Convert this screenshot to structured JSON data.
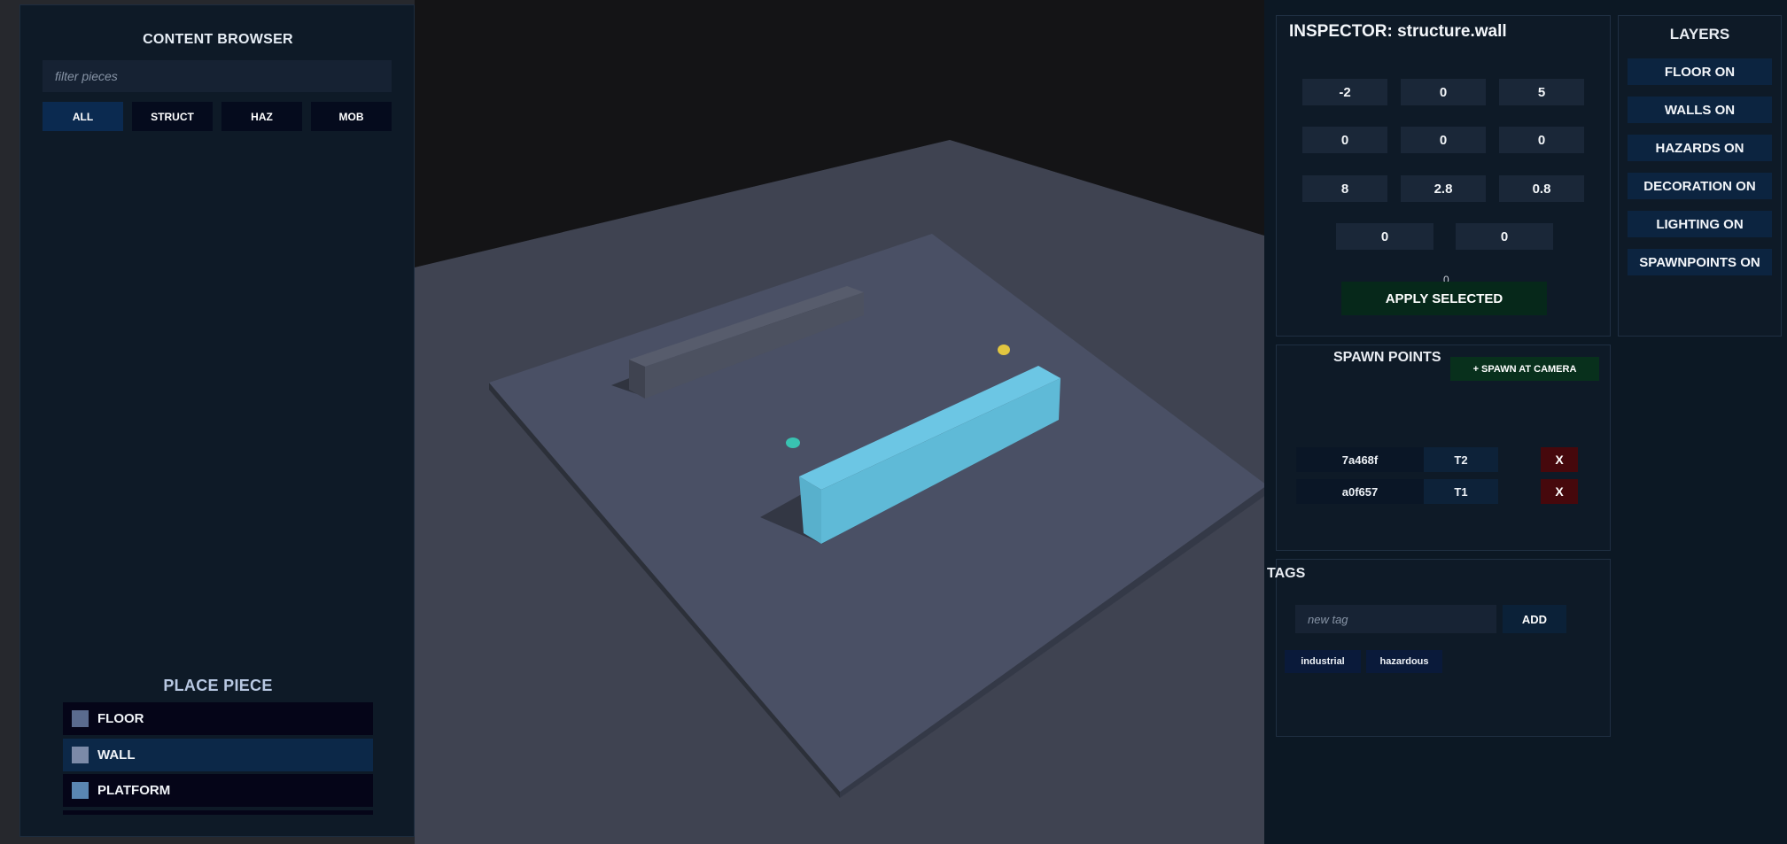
{
  "content_browser": {
    "title": "CONTENT BROWSER",
    "filter_placeholder": "filter pieces",
    "filters": [
      "ALL",
      "STRUCT",
      "HAZ",
      "MOB"
    ],
    "active_filter": "ALL"
  },
  "place_piece": {
    "title": "PLACE PIECE",
    "items": [
      "FLOOR",
      "WALL",
      "PLATFORM"
    ],
    "selected": "WALL"
  },
  "inspector": {
    "title": "INSPECTOR: structure.wall",
    "position": [
      "-2",
      "0",
      "5"
    ],
    "rotation": [
      "0",
      "0",
      "0"
    ],
    "scale": [
      "8",
      "2.8",
      "0.8"
    ],
    "extra": [
      "0",
      "0"
    ],
    "partial_value": "0",
    "apply_label": "APPLY SELECTED"
  },
  "layers": {
    "title": "LAYERS",
    "items": [
      "FLOOR ON",
      "WALLS ON",
      "HAZARDS ON",
      "DECORATION ON",
      "LIGHTING ON",
      "SPAWNPOINTS ON"
    ]
  },
  "spawn_points": {
    "title": "SPAWN POINTS",
    "spawn_label": "+ SPAWN AT CAMERA",
    "rows": [
      {
        "id": "7a468f",
        "team": "T2",
        "delete": "X"
      },
      {
        "id": "a0f657",
        "team": "T1",
        "delete": "X"
      }
    ]
  },
  "tags": {
    "title": "TAGS",
    "input_placeholder": "new tag",
    "add_label": "ADD",
    "items": [
      "industrial",
      "hazardous"
    ]
  },
  "colors": {
    "selected_wall": "#6cc6e4",
    "spawn_marker_a": "#39c2b1",
    "spawn_marker_b": "#e2c640",
    "panel_bg": "#0e1a27"
  }
}
